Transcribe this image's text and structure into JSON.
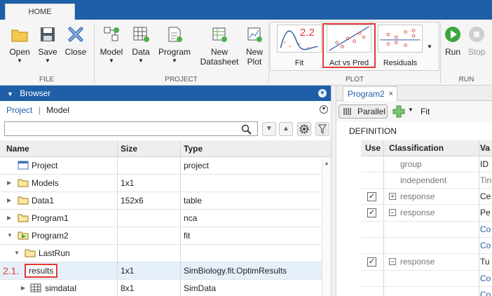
{
  "ribbon": {
    "home_tab": "HOME",
    "file": {
      "label": "FILE",
      "open": "Open",
      "save": "Save",
      "close": "Close"
    },
    "project": {
      "label": "PROJECT",
      "model": "Model",
      "data": "Data",
      "program": "Program",
      "new_datasheet_1": "New",
      "new_datasheet_2": "Datasheet",
      "new_plot_1": "New",
      "new_plot_2": "Plot"
    },
    "plot": {
      "label": "PLOT",
      "fit": "Fit",
      "act_vs_pred": "Act vs Pred",
      "residuals": "Residuals",
      "fit_annotation": "2.2"
    },
    "run": {
      "label": "RUN",
      "run": "Run",
      "stop": "Stop"
    }
  },
  "browser": {
    "title": "Browser",
    "view_project": "Project",
    "view_separator": "|",
    "view_model": "Model",
    "search_placeholder": "",
    "columns": {
      "name": "Name",
      "size": "Size",
      "type": "Type"
    },
    "rows": [
      {
        "name": "Project",
        "size": "",
        "type": "project"
      },
      {
        "name": "Models",
        "size": "1x1",
        "type": ""
      },
      {
        "name": "Data1",
        "size": "152x6",
        "type": "table"
      },
      {
        "name": "Program1",
        "size": "",
        "type": "nca"
      },
      {
        "name": "Program2",
        "size": "",
        "type": "fit"
      },
      {
        "name": "LastRun",
        "size": "",
        "type": ""
      },
      {
        "name": "results",
        "size": "1x1",
        "type": "SimBiology.fit.OptimResults",
        "annotation": "2.1."
      },
      {
        "name": "simdataI",
        "size": "8x1",
        "type": "SimData"
      }
    ]
  },
  "program": {
    "tab_label": "Program2",
    "close_symbol": "×",
    "parallel_label": "Parallel",
    "fit_label": "Fit",
    "definition_label": "DEFINITION",
    "columns": {
      "use": "Use",
      "classification": "Classification",
      "value": "Va"
    },
    "rows": [
      {
        "classification": "group",
        "value": "ID",
        "checked": false,
        "kind": "plain"
      },
      {
        "classification": "independent",
        "value": "Tin",
        "checked": false,
        "kind": "plain"
      },
      {
        "classification": "response",
        "value": "Ce",
        "checked": true,
        "kind": "plus"
      },
      {
        "classification": "response",
        "value": "Pe",
        "checked": true,
        "kind": "minus"
      },
      {
        "classification": "",
        "value": "Co",
        "checked": false,
        "kind": "sub"
      },
      {
        "classification": "",
        "value": "Co",
        "checked": false,
        "kind": "sub"
      },
      {
        "classification": "response",
        "value": "Tu",
        "checked": true,
        "kind": "minus"
      },
      {
        "classification": "",
        "value": "Co",
        "checked": false,
        "kind": "sub"
      },
      {
        "classification": "",
        "value": "Co",
        "checked": false,
        "kind": "sub"
      }
    ]
  },
  "colors": {
    "accent": "#1f5fa8",
    "annotation": "#e53935",
    "selection": "#e6f0fb"
  }
}
